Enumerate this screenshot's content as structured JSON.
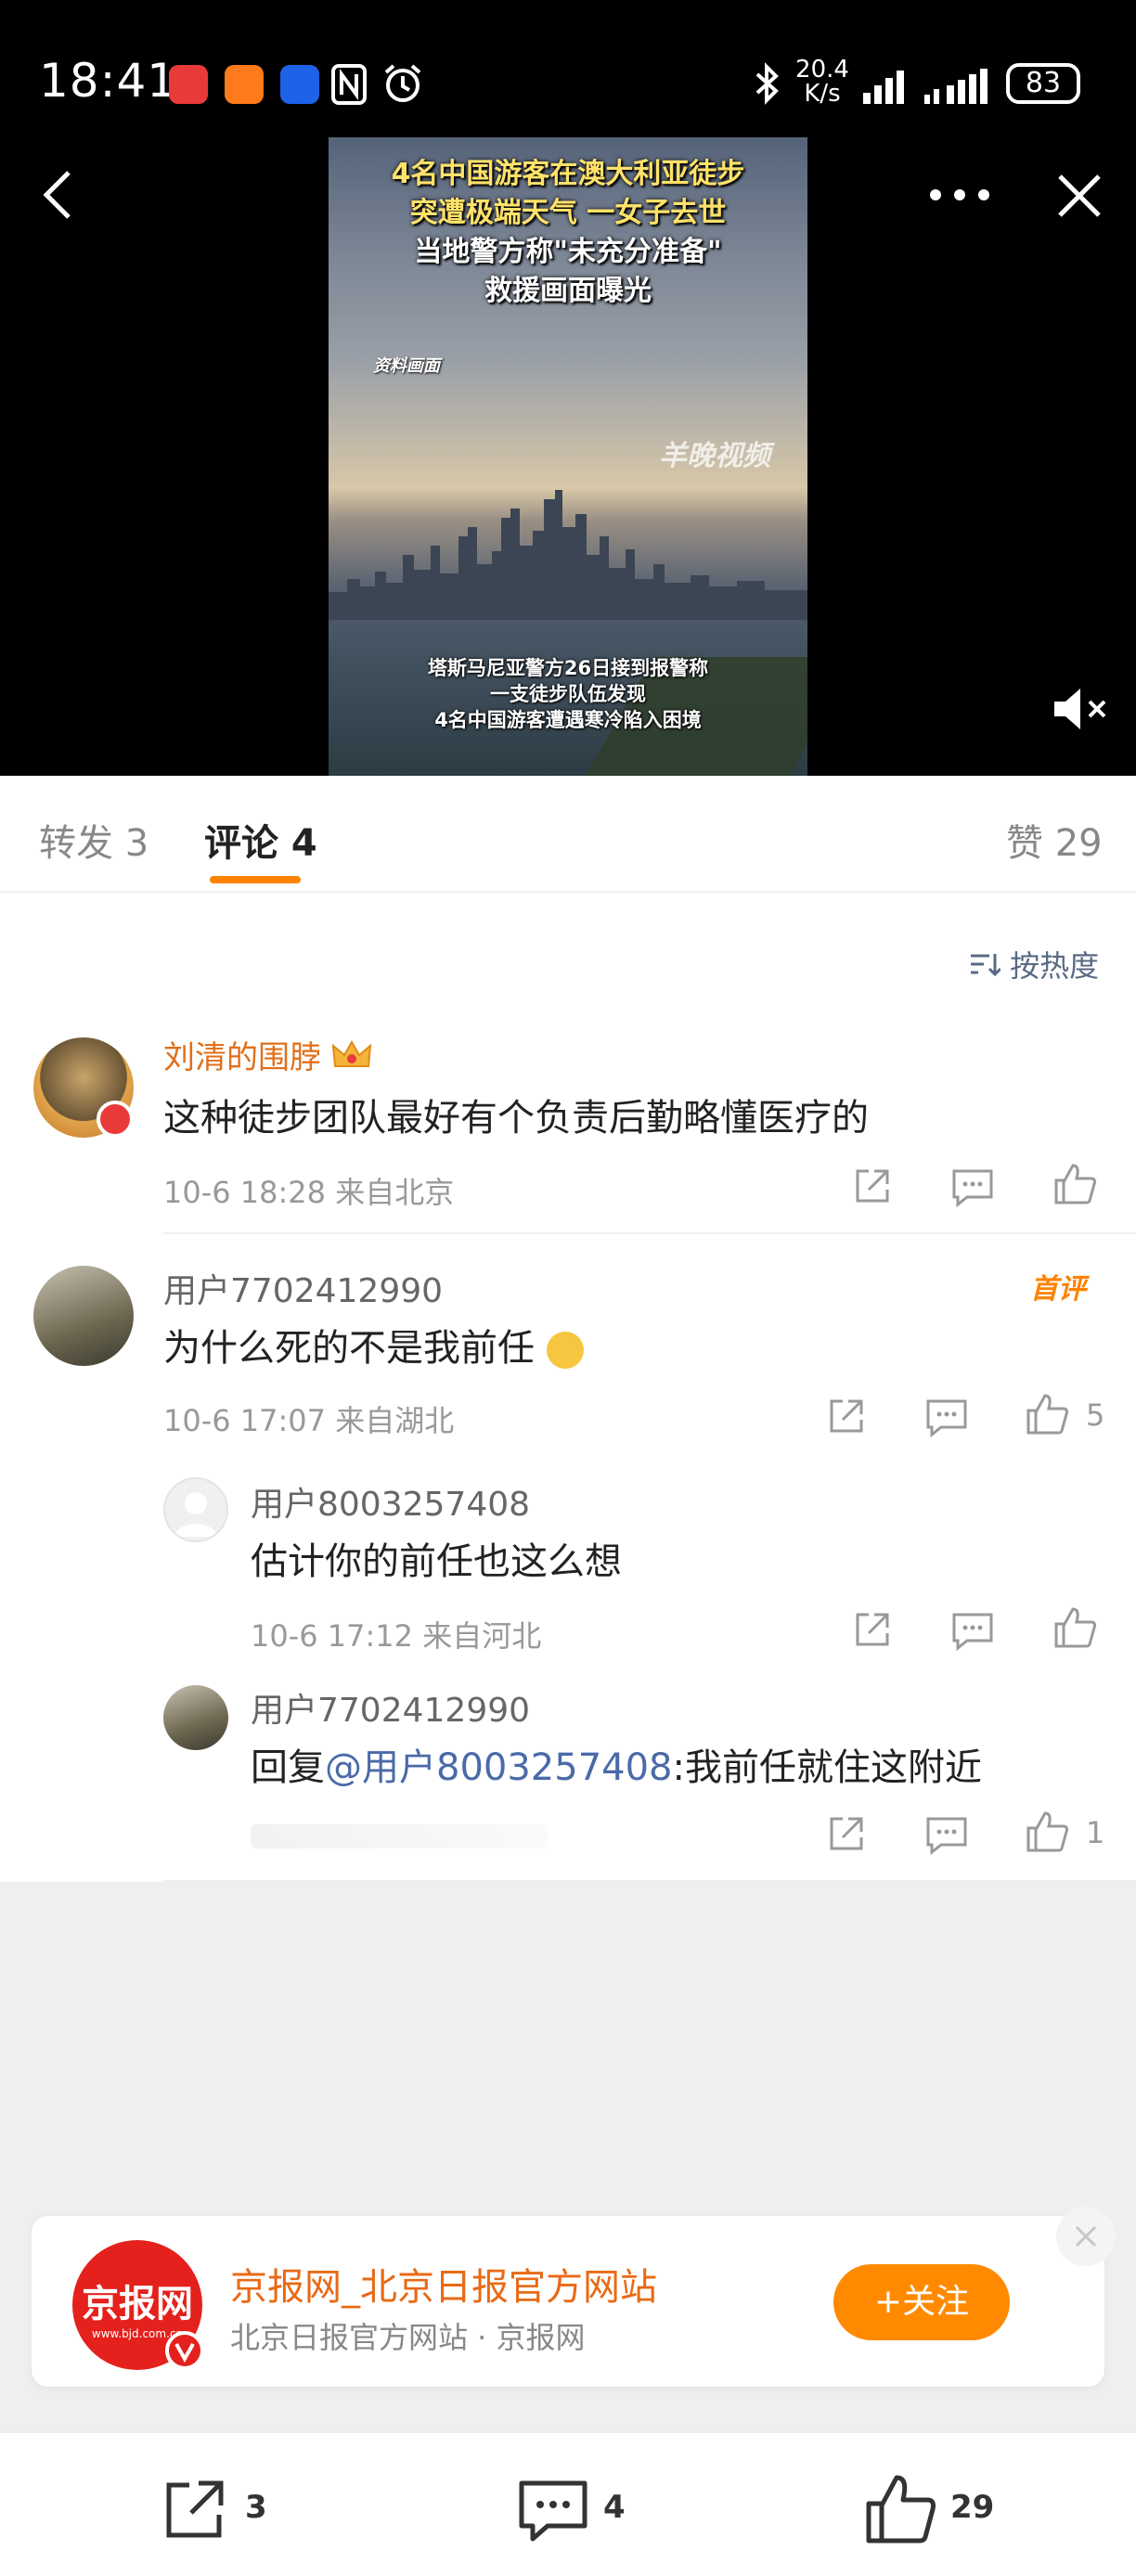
{
  "status_bar": {
    "time": "18:41",
    "network_speed_value": "20.4",
    "network_speed_unit": "K/s",
    "battery": "83"
  },
  "video": {
    "title_lines": [
      "4名中国游客在澳大利亚徒步",
      "突遭极端天气 一女子去世",
      "当地警方称\"未充分准备\"",
      "救援画面曝光"
    ],
    "tag": "资料画面",
    "watermark": "羊晚视频",
    "caption_lines": [
      "塔斯马尼亚警方26日接到报警称",
      "一支徒步队伍发现",
      "4名中国游客遭遇寒冷陷入困境"
    ]
  },
  "tabs": {
    "repost": "转发 3",
    "comment": "评论 4",
    "like": "赞 29"
  },
  "sort": {
    "label": "按热度"
  },
  "comments": [
    {
      "username": "刘清的围脖",
      "content": "这种徒步团队最好有个负责后勤略懂医疗的",
      "meta": "10-6 18:28  来自北京",
      "likes": ""
    },
    {
      "username": "用户7702412990",
      "badge": "首评",
      "content": "为什么死的不是我前任",
      "meta": "10-6 17:07  来自湖北",
      "likes": "5"
    }
  ],
  "replies": [
    {
      "username": "用户8003257408",
      "content": "估计你的前任也这么想",
      "meta": "10-6 17:12  来自河北",
      "likes": ""
    },
    {
      "username": "用户7702412990",
      "content_prefix": "回复",
      "mention": "@用户8003257408",
      "content_suffix": ":我前任就住这附近",
      "likes": "1"
    }
  ],
  "ad": {
    "logo_text": "京报网",
    "logo_url": "www.bjd.com.cn",
    "title": "京报网_北京日报官方网站",
    "subtitle": "北京日报官方网站 · 京报网",
    "follow_label": "+关注"
  },
  "bottom_bar": {
    "repost_count": "3",
    "comment_count": "4",
    "like_count": "29"
  },
  "colors": {
    "accent": "#ff8200",
    "username_orange": "#e0701a",
    "mention_blue": "#4a6aa8",
    "video_title_yellow": "#ffe26a"
  }
}
